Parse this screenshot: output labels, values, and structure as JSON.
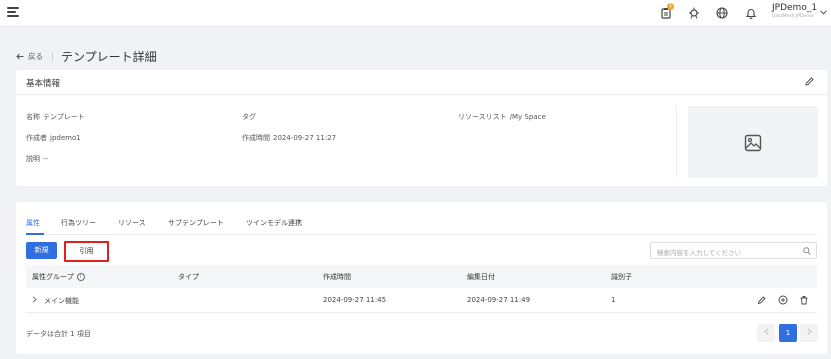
{
  "topbar": {
    "notification_count": "1",
    "user_name": "JPDemo_1",
    "user_org": "DataMesh JPDemo"
  },
  "header": {
    "back_label": "戻る",
    "title": "テンプレート詳細"
  },
  "basic_info": {
    "section_title": "基本情報",
    "name_label": "名称",
    "name_value": "テンプレート",
    "tag_label": "タグ",
    "resource_label": "リソースリスト",
    "resource_value": "/My Space",
    "creator_label": "作成者",
    "creator_value": "jpdemo1",
    "created_label": "作成時間",
    "created_value": "2024-09-27 11:27",
    "desc_label": "説明",
    "desc_value": "--"
  },
  "tabs": [
    "属性",
    "行為ツリー",
    "リソース",
    "サブテンプレート",
    "ツインモデル連携"
  ],
  "toolbar": {
    "new_label": "新規",
    "ref_label": "引用",
    "search_placeholder": "検索内容を入力してください"
  },
  "table": {
    "headers": [
      "属性グループ",
      "タイプ",
      "作成時間",
      "編集日付",
      "識別子"
    ],
    "rows": [
      {
        "group": "メイン機能",
        "type": "",
        "created": "2024-09-27 11:45",
        "edited": "2024-09-27 11:49",
        "id": "1"
      }
    ]
  },
  "footer": {
    "total_text": "データは合計 1 項目",
    "current_page": "1"
  },
  "colors": {
    "accent": "#2f6fe0",
    "highlight_border": "#e02020",
    "badge": "#f5a623"
  }
}
